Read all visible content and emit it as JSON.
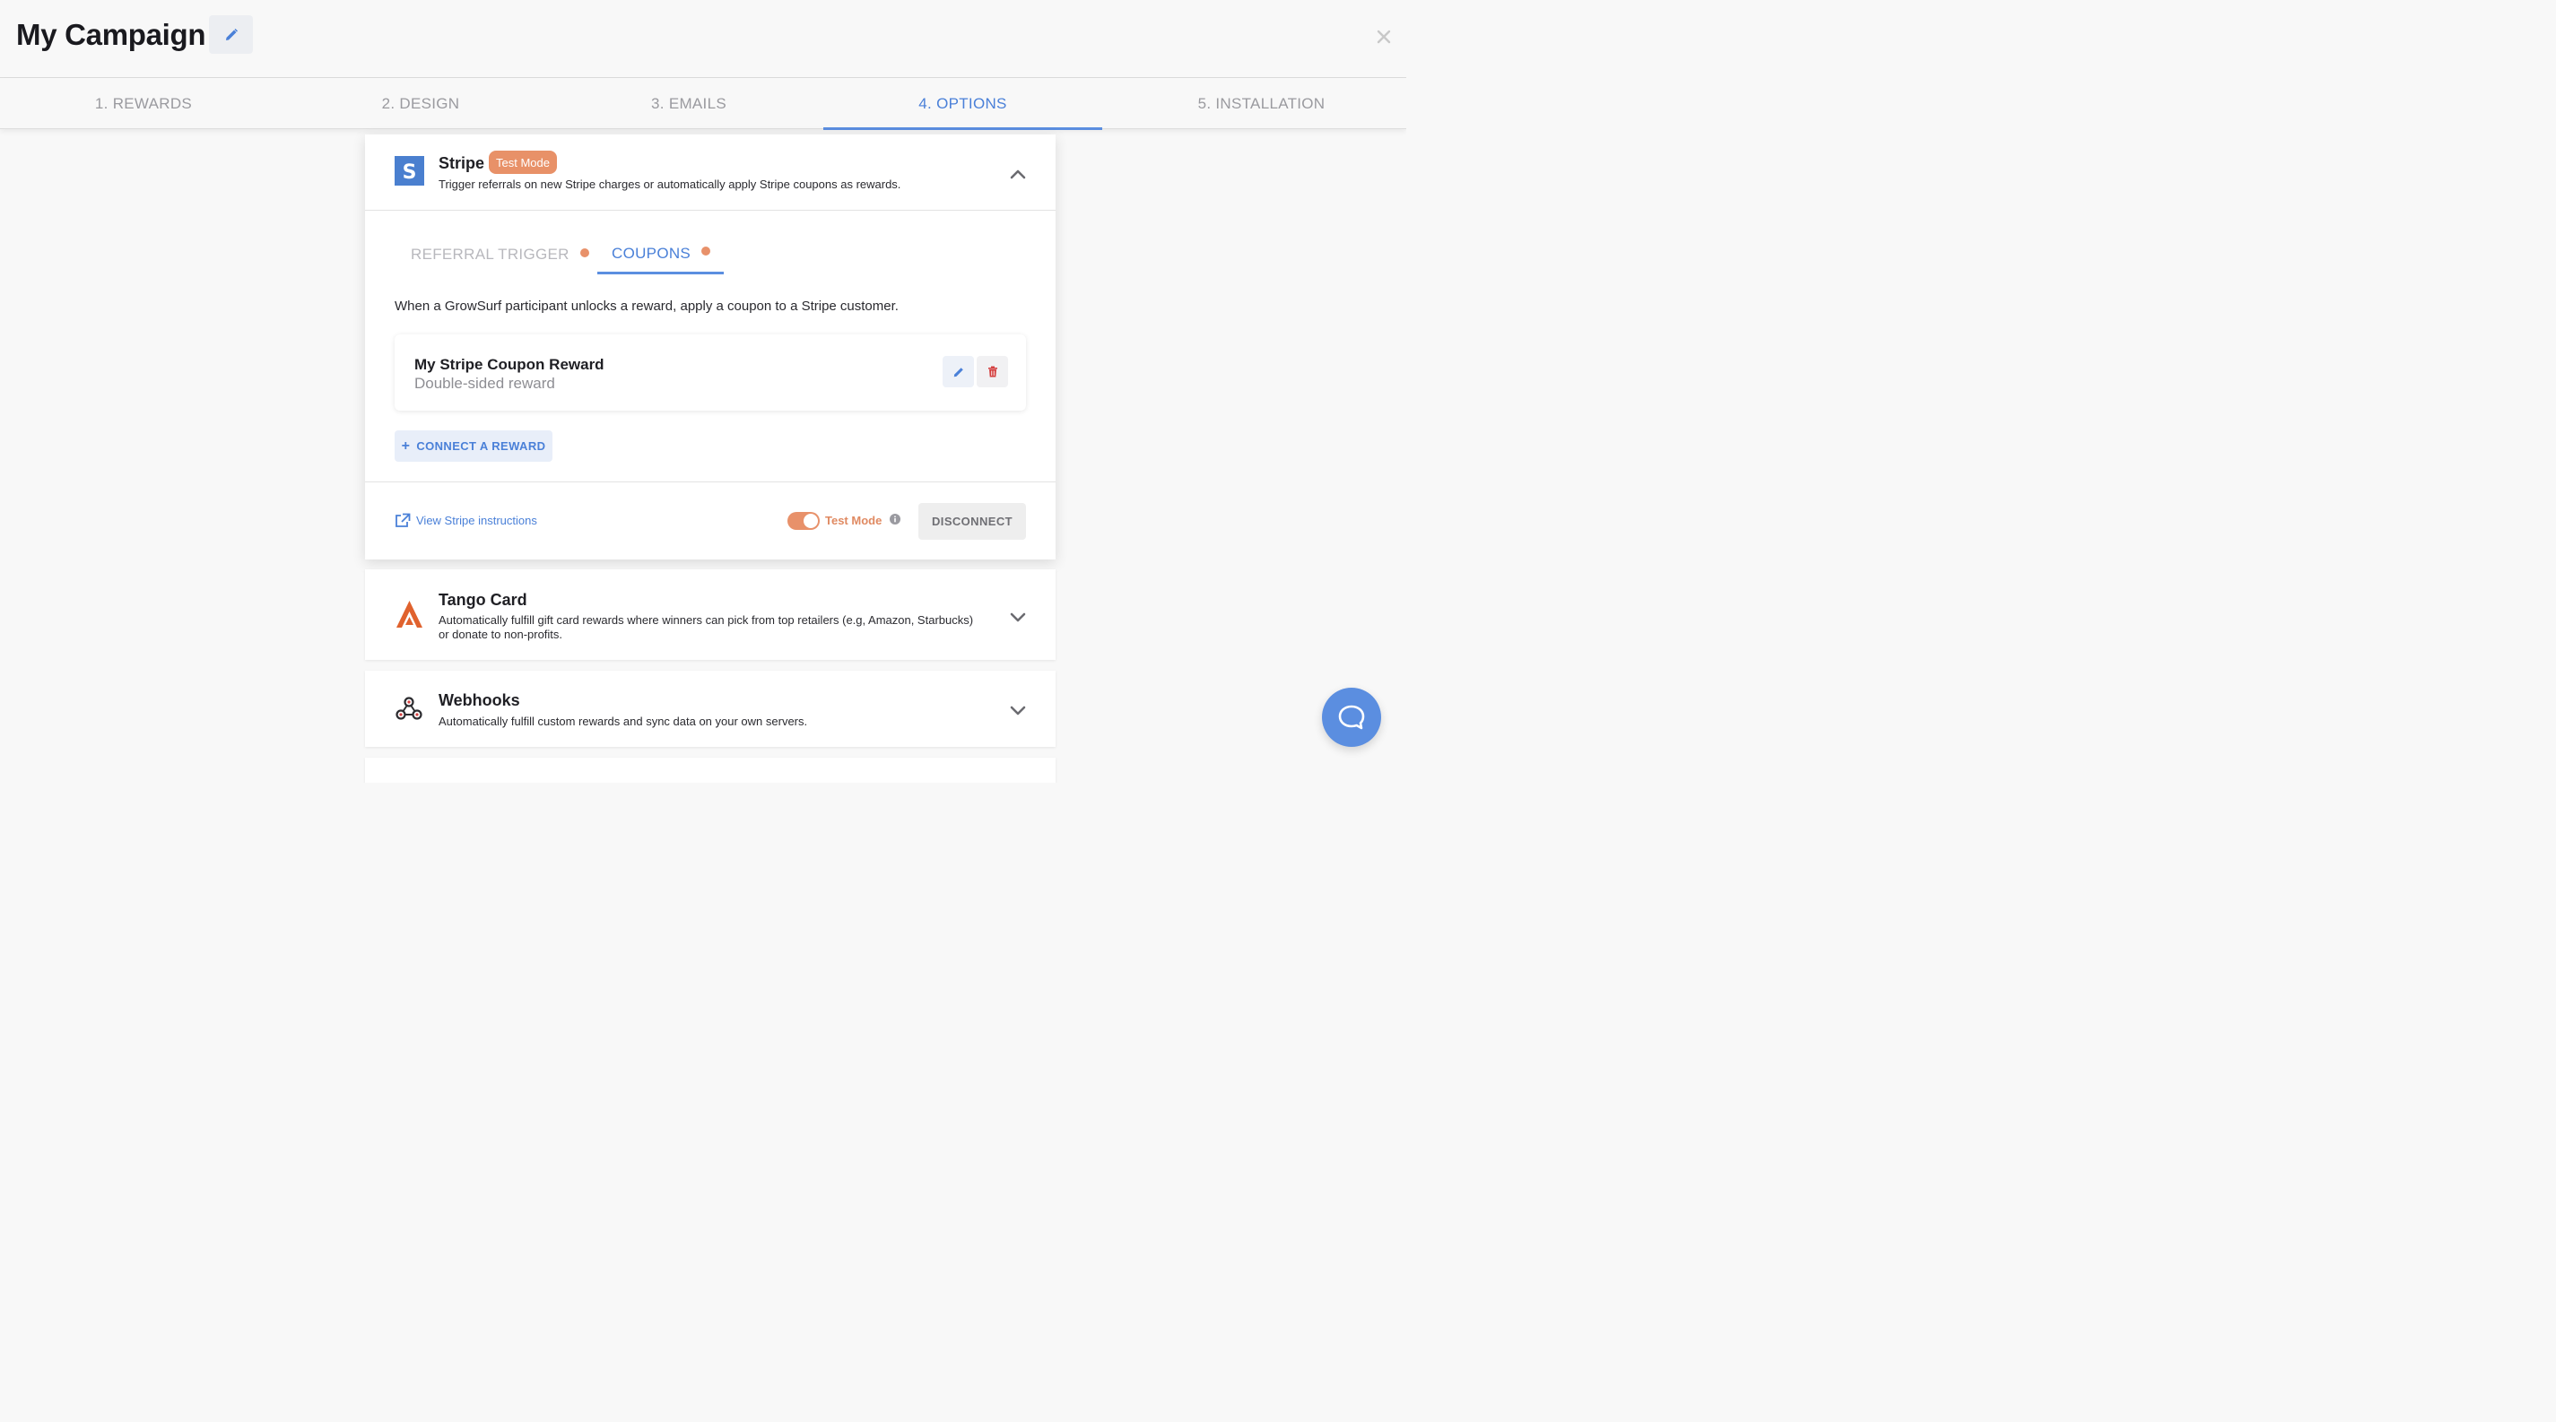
{
  "header": {
    "title": "My Campaign",
    "edit_icon": "pencil-icon",
    "close_icon": "close-icon"
  },
  "tabs": [
    {
      "label": "1. REWARDS",
      "active": false
    },
    {
      "label": "2. DESIGN",
      "active": false
    },
    {
      "label": "3. EMAILS",
      "active": false
    },
    {
      "label": "4. OPTIONS",
      "active": true
    },
    {
      "label": "5. INSTALLATION",
      "active": false
    }
  ],
  "stripe": {
    "name": "Stripe",
    "badge": "Test Mode",
    "description": "Trigger referrals on new Stripe charges or automatically apply Stripe coupons as rewards.",
    "subtabs": [
      {
        "label": "REFERRAL TRIGGER",
        "active": false
      },
      {
        "label": "COUPONS",
        "active": true
      }
    ],
    "intro": "When a GrowSurf participant unlocks a reward, apply a coupon to a Stripe customer.",
    "reward": {
      "name": "My Stripe Coupon Reward",
      "subtitle": "Double-sided reward"
    },
    "connect_button": "CONNECT A REWARD",
    "instructions_link": "View Stripe instructions",
    "toggle_label": "Test Mode",
    "toggle_on": true,
    "disconnect_button": "DISCONNECT"
  },
  "integrations": [
    {
      "name": "Tango Card",
      "description_line1": "Automatically fulfill gift card rewards where winners can pick from top retailers (e.g, Amazon, Starbucks)",
      "description_line2": "or donate to non-profits."
    },
    {
      "name": "Webhooks",
      "description_line1": "Automatically fulfill custom rewards and sync data on your own servers."
    }
  ],
  "colors": {
    "accent": "#5b8ee0",
    "orange": "#e8916a",
    "stripe_blue": "#4a7fcf",
    "tango": "#e0622e"
  }
}
